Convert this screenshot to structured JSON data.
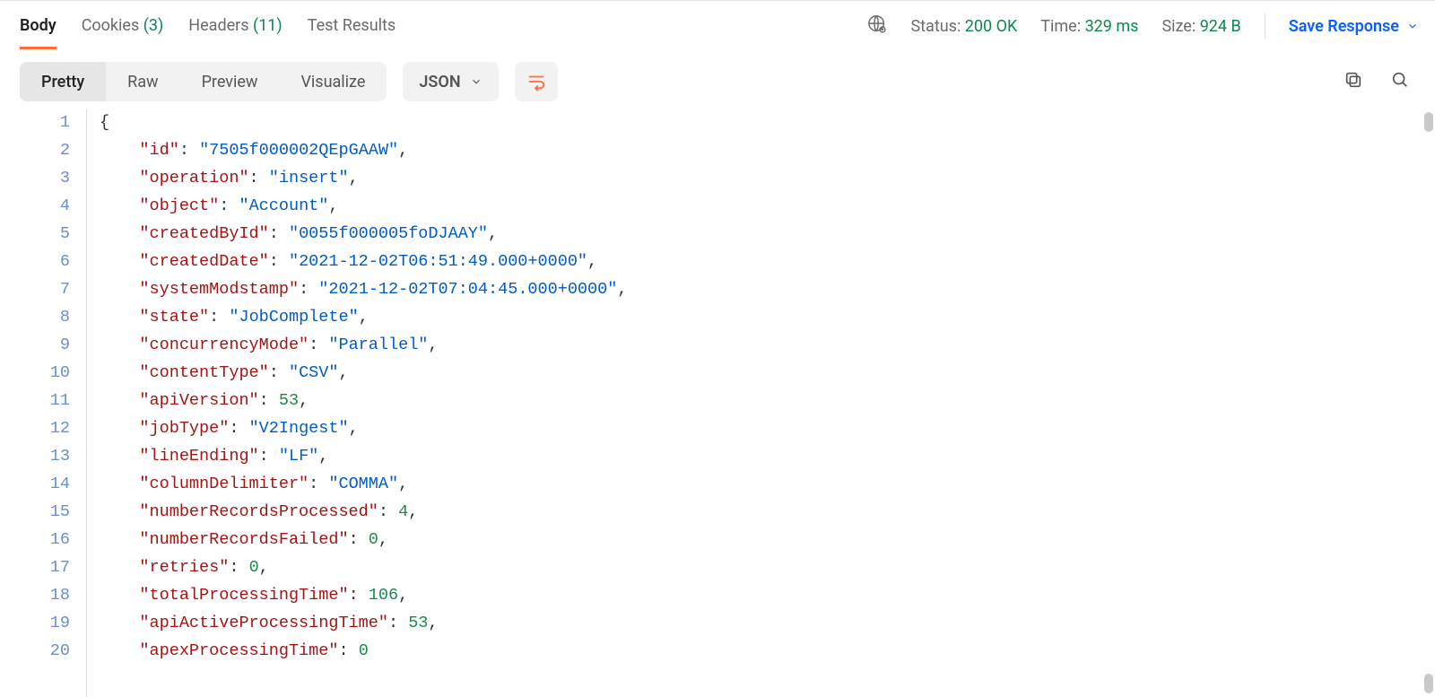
{
  "tabs": {
    "body": "Body",
    "cookies_label": "Cookies",
    "cookies_count": "(3)",
    "headers_label": "Headers",
    "headers_count": "(11)",
    "test_results": "Test Results"
  },
  "status": {
    "label": "Status:",
    "value": "200 OK",
    "time_label": "Time:",
    "time_value": "329 ms",
    "size_label": "Size:",
    "size_value": "924 B"
  },
  "save_response": "Save Response",
  "view_modes": {
    "pretty": "Pretty",
    "raw": "Raw",
    "preview": "Preview",
    "visualize": "Visualize"
  },
  "format_selected": "JSON",
  "response_body": {
    "id": "7505f000002QEpGAAW",
    "operation": "insert",
    "object": "Account",
    "createdById": "0055f000005foDJAAY",
    "createdDate": "2021-12-02T06:51:49.000+0000",
    "systemModstamp": "2021-12-02T07:04:45.000+0000",
    "state": "JobComplete",
    "concurrencyMode": "Parallel",
    "contentType": "CSV",
    "apiVersion": 53.0,
    "jobType": "V2Ingest",
    "lineEnding": "LF",
    "columnDelimiter": "COMMA",
    "numberRecordsProcessed": 4,
    "numberRecordsFailed": 0,
    "retries": 0,
    "totalProcessingTime": 106,
    "apiActiveProcessingTime": 53,
    "apexProcessingTime": 0
  },
  "visible_key_order": [
    "id",
    "operation",
    "object",
    "createdById",
    "createdDate",
    "systemModstamp",
    "state",
    "concurrencyMode",
    "contentType",
    "apiVersion",
    "jobType",
    "lineEnding",
    "columnDelimiter",
    "numberRecordsProcessed",
    "numberRecordsFailed",
    "retries",
    "totalProcessingTime",
    "apiActiveProcessingTime",
    "apexProcessingTime"
  ]
}
